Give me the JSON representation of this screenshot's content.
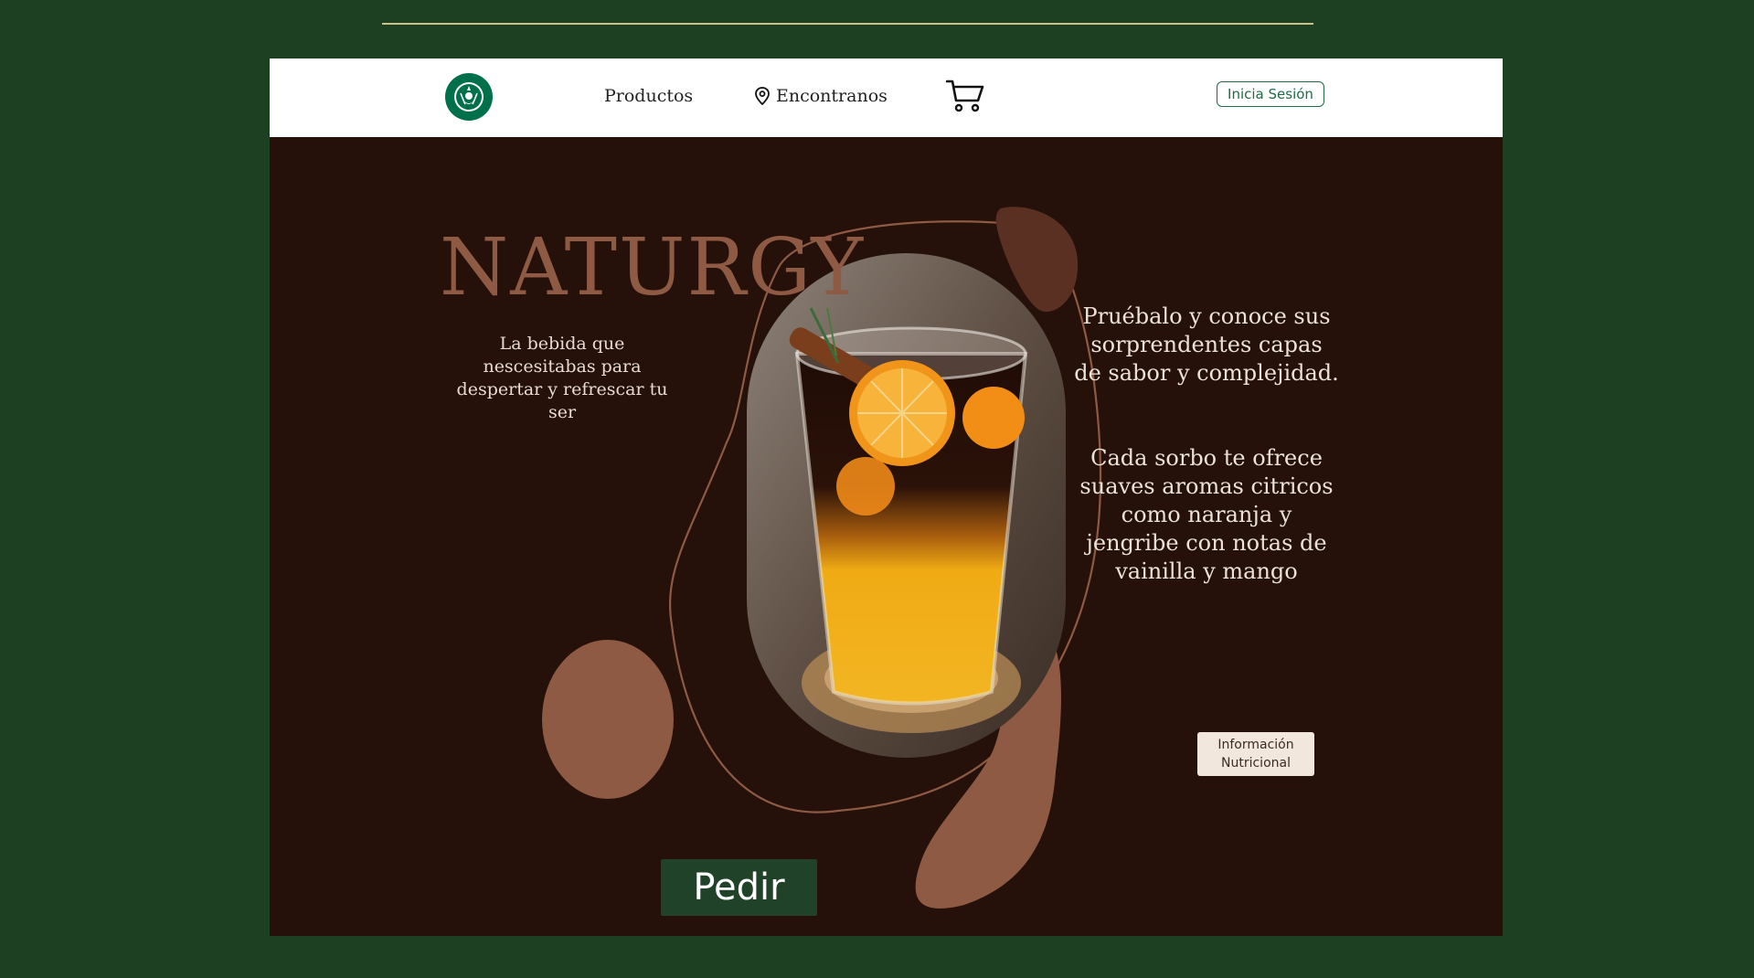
{
  "nav": {
    "logo_alt": "Starbucks",
    "productos": "Productos",
    "encontranos": "Encontranos",
    "login": "Inicia Sesión"
  },
  "hero": {
    "title": "NATURGY",
    "subtitle": "La bebida que nescesitabas para despertar y refrescar tu ser",
    "desc_1": "Pruébalo y conoce sus sorprendentes capas de sabor y complejidad.",
    "desc_2": "Cada sorbo te ofrece suaves aromas citricos como naranja y jengribe con notas de vainilla y mango",
    "info_button": "Información Nutricional",
    "order_button": "Pedir"
  },
  "icons": {
    "logo": "starbucks-logo-icon",
    "location": "location-pin-icon",
    "cart": "cart-icon"
  },
  "colors": {
    "page_bg": "#1c4021",
    "hero_bg": "#25100a",
    "accent_brown": "#8e5a44",
    "brand_green": "#1d6b47",
    "order_button_bg": "#1f4229"
  }
}
